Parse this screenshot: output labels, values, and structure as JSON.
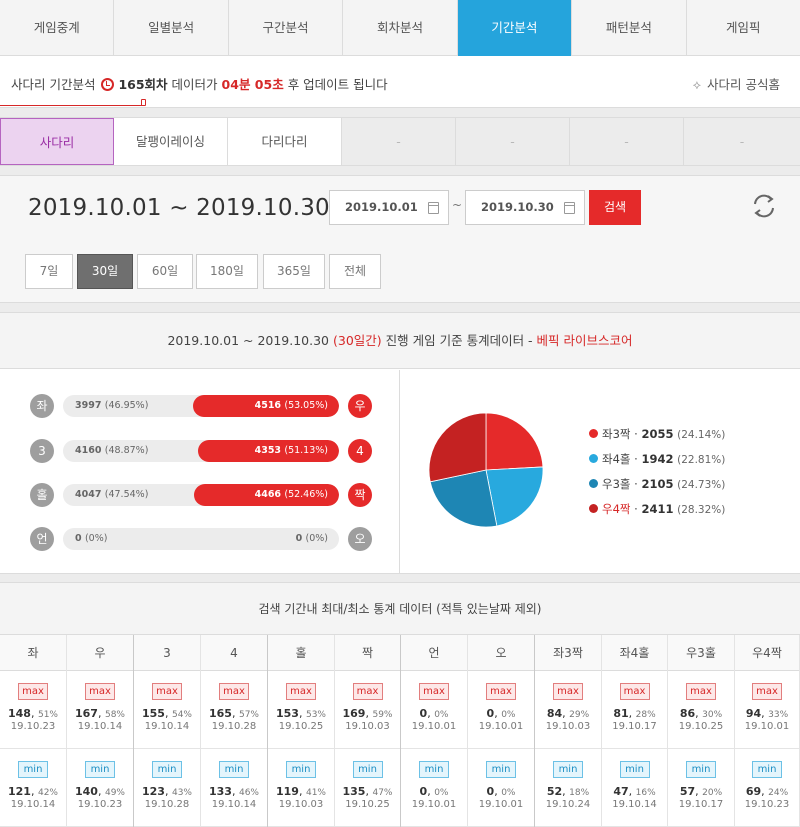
{
  "top_tabs": [
    {
      "label": "게임중계",
      "active": false
    },
    {
      "label": "일별분석",
      "active": false
    },
    {
      "label": "구간분석",
      "active": false
    },
    {
      "label": "회차분석",
      "active": false
    },
    {
      "label": "기간분석",
      "active": true
    },
    {
      "label": "패턴분석",
      "active": false
    },
    {
      "label": "게임픽",
      "active": false
    }
  ],
  "notice": {
    "prefix": "사다리 기간분석",
    "round": "165회차",
    "mid": "데이터가",
    "time": "04분 05초",
    "suffix": "후 업데이트 됩니다",
    "official_link": "사다리 공식홈",
    "progress": 0.18
  },
  "sub_tabs": [
    "사다리",
    "달팽이레이싱",
    "다리다리",
    "-",
    "-",
    "-",
    "-"
  ],
  "date_filter": {
    "range_title": "2019.10.01 ~ 2019.10.30",
    "start": "2019.10.01",
    "tilde": "~",
    "end": "2019.10.30",
    "search_label": "검색",
    "periods": [
      {
        "label": "7일",
        "active": false
      },
      {
        "label": "30일",
        "active": true
      },
      {
        "label": "60일",
        "active": false
      },
      {
        "label": "180일",
        "active": false
      },
      {
        "label": "365일",
        "active": false
      },
      {
        "label": "전체",
        "active": false
      }
    ]
  },
  "stats": {
    "head_range": "2019.10.01 ~ 2019.10.30",
    "head_days": "(30일간)",
    "head_text": "진행 게임 기준 통계데이터 -",
    "head_source": "베픽 라이브스코어",
    "rows": [
      {
        "left_icon": "좌",
        "left_count": "3997",
        "left_pct": "(46.95%)",
        "right_count": "4516",
        "right_pct": "(53.05%)",
        "right_icon": "우",
        "right_share": 0.5305
      },
      {
        "left_icon": "3",
        "left_count": "4160",
        "left_pct": "(48.87%)",
        "right_count": "4353",
        "right_pct": "(51.13%)",
        "right_icon": "4",
        "right_share": 0.5113
      },
      {
        "left_icon": "홀",
        "left_count": "4047",
        "left_pct": "(47.54%)",
        "right_count": "4466",
        "right_pct": "(52.46%)",
        "right_icon": "짝",
        "right_share": 0.5246
      },
      {
        "left_icon": "언",
        "left_count": "0",
        "left_pct": "(0%)",
        "right_count": "0",
        "right_pct": "(0%)",
        "right_icon": "오",
        "right_share": 0
      }
    ],
    "legend": [
      {
        "label": "좌3짝",
        "count": "2055",
        "pct": "(24.14%)",
        "color": "#e52a2a",
        "highlight": false
      },
      {
        "label": "좌4홀",
        "count": "1942",
        "pct": "(22.81%)",
        "color": "#28a9de",
        "highlight": false
      },
      {
        "label": "우3홀",
        "count": "2105",
        "pct": "(24.73%)",
        "color": "#1e86b4",
        "highlight": false
      },
      {
        "label": "우4짝",
        "count": "2411",
        "pct": "(28.32%)",
        "color": "#c42222",
        "highlight": true
      }
    ]
  },
  "chart_data": {
    "type": "pie",
    "categories": [
      "좌3짝",
      "좌4홀",
      "우3홀",
      "우4짝"
    ],
    "values": [
      2055,
      1942,
      2105,
      2411
    ],
    "colors": [
      "#e52a2a",
      "#28a9de",
      "#1e86b4",
      "#c42222"
    ]
  },
  "minmax": {
    "title": "검색 기간내 최대/최소 통계 데이터 (적특 있는날짜 제외)",
    "max_label": "max",
    "min_label": "min",
    "columns": [
      {
        "head": "좌",
        "max_val": "148",
        "max_pct": "51%",
        "max_date": "19.10.23",
        "min_val": "121",
        "min_pct": "42%",
        "min_date": "19.10.14"
      },
      {
        "head": "우",
        "max_val": "167",
        "max_pct": "58%",
        "max_date": "19.10.14",
        "min_val": "140",
        "min_pct": "49%",
        "min_date": "19.10.23"
      },
      {
        "head": "3",
        "max_val": "155",
        "max_pct": "54%",
        "max_date": "19.10.14",
        "min_val": "123",
        "min_pct": "43%",
        "min_date": "19.10.28"
      },
      {
        "head": "4",
        "max_val": "165",
        "max_pct": "57%",
        "max_date": "19.10.28",
        "min_val": "133",
        "min_pct": "46%",
        "min_date": "19.10.14"
      },
      {
        "head": "홀",
        "max_val": "153",
        "max_pct": "53%",
        "max_date": "19.10.25",
        "min_val": "119",
        "min_pct": "41%",
        "min_date": "19.10.03"
      },
      {
        "head": "짝",
        "max_val": "169",
        "max_pct": "59%",
        "max_date": "19.10.03",
        "min_val": "135",
        "min_pct": "47%",
        "min_date": "19.10.25"
      },
      {
        "head": "언",
        "max_val": "0",
        "max_pct": "0%",
        "max_date": "19.10.01",
        "min_val": "0",
        "min_pct": "0%",
        "min_date": "19.10.01"
      },
      {
        "head": "오",
        "max_val": "0",
        "max_pct": "0%",
        "max_date": "19.10.01",
        "min_val": "0",
        "min_pct": "0%",
        "min_date": "19.10.01"
      },
      {
        "head": "좌3짝",
        "max_val": "84",
        "max_pct": "29%",
        "max_date": "19.10.03",
        "min_val": "52",
        "min_pct": "18%",
        "min_date": "19.10.24"
      },
      {
        "head": "좌4홀",
        "max_val": "81",
        "max_pct": "28%",
        "max_date": "19.10.17",
        "min_val": "47",
        "min_pct": "16%",
        "min_date": "19.10.14"
      },
      {
        "head": "우3홀",
        "max_val": "86",
        "max_pct": "30%",
        "max_date": "19.10.25",
        "min_val": "57",
        "min_pct": "20%",
        "min_date": "19.10.17"
      },
      {
        "head": "우4짝",
        "max_val": "94",
        "max_pct": "33%",
        "max_date": "19.10.01",
        "min_val": "69",
        "min_pct": "24%",
        "min_date": "19.10.23"
      }
    ]
  }
}
